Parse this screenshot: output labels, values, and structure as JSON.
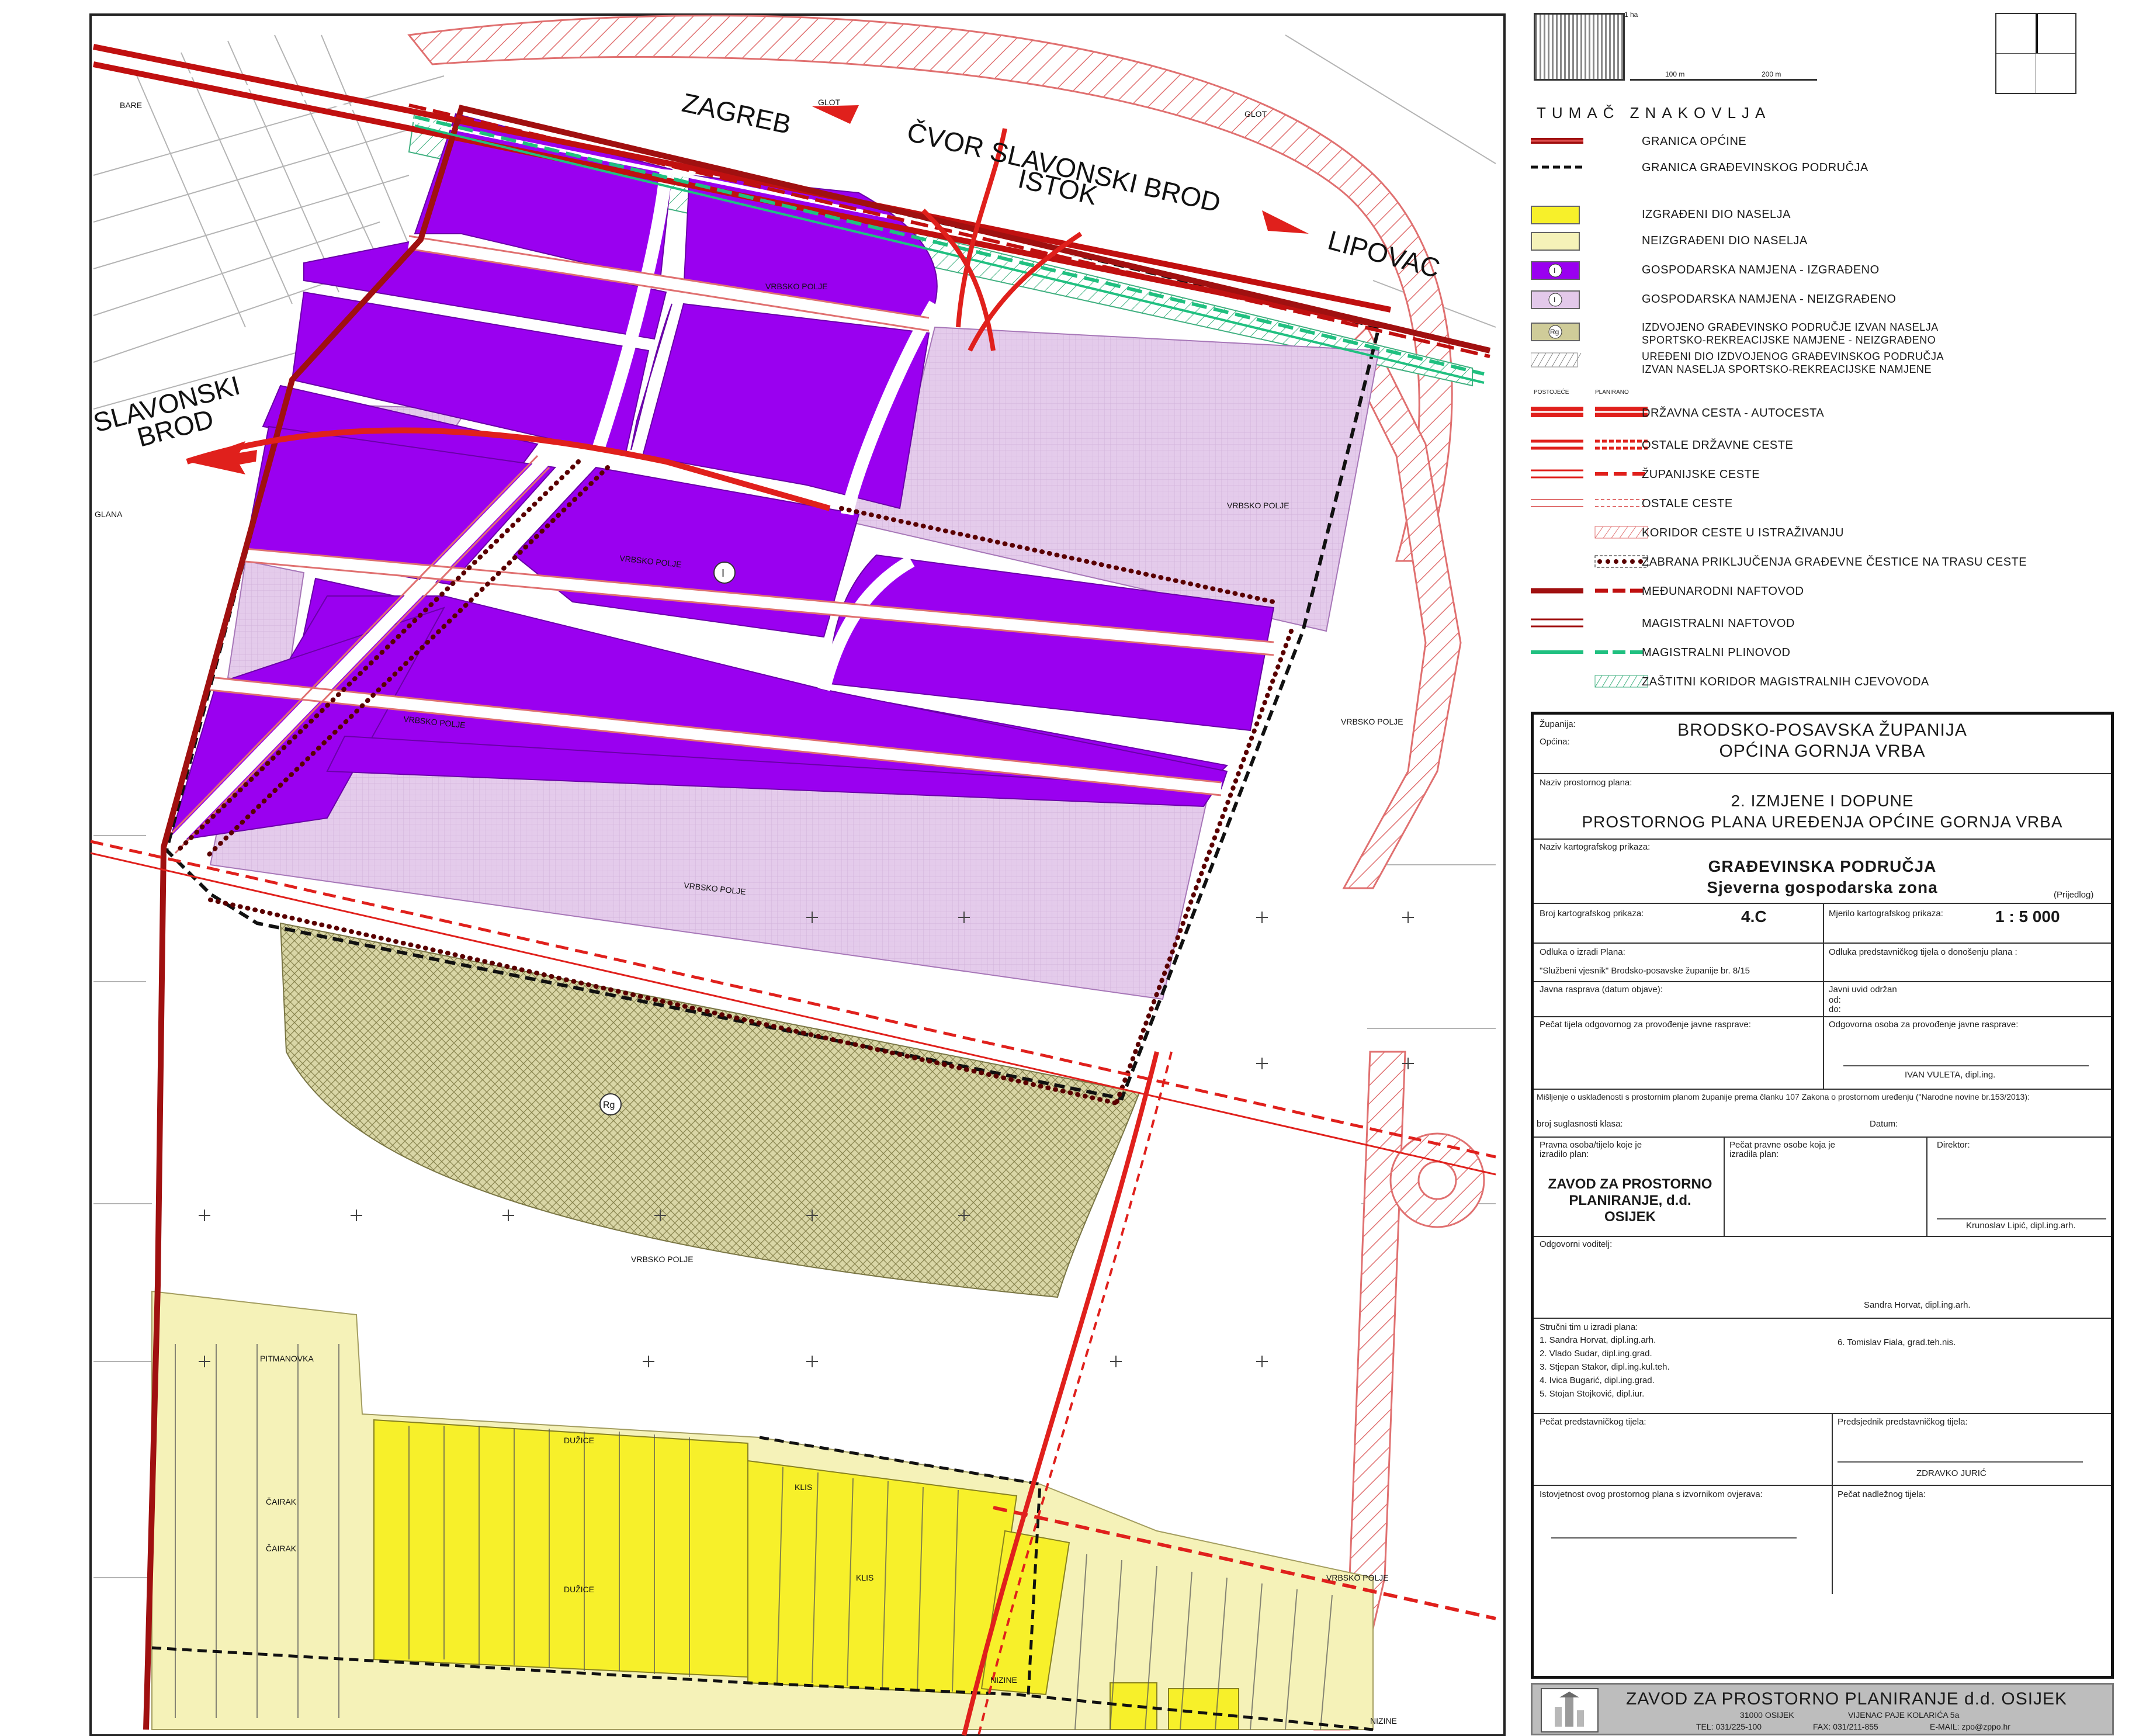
{
  "map": {
    "labels": {
      "zagreb": "ZAGREB",
      "cvor": "ČVOR SLAVONSKI BROD",
      "istok": "ISTOK",
      "lipovac": "LIPOVAC",
      "slavonski": "SLAVONSKI",
      "brod": "BROD",
      "glot1": "GLOT",
      "glot2": "GLOT",
      "bare": "BARE",
      "glana": "GLANA",
      "vrbsko_polje": "VRBSKO POLJE",
      "vrbsko_polje_2": "VRBSKO POLJE",
      "vrbsko_polje_3": "VRBSKO POLJE",
      "vrbsko_polje_4": "VRBSKO POLJE",
      "vrbsko_polje_5": "VRBSKO POLJE",
      "vrbsko_polje_6": "VRBSKO POLJE",
      "vrbsko_polje_7": "VRBSKO POLJE",
      "vrbsko_polje_8": "VRBSKO POLJE",
      "pitmanovka": "PITMANOVKA",
      "cairak1": "ČAIRAK",
      "cairak2": "ČAIRAK",
      "duzice1": "DUŽICE",
      "duzice2": "DUŽICE",
      "klis1": "KLIS",
      "klis2": "KLIS",
      "nizine1": "NIZINE",
      "nizine2": "NIZINE",
      "zone_i": "I",
      "zone_rg": "Rg"
    },
    "colors": {
      "built_settlement": "#f7f02a",
      "unbuilt_settlement": "#f5f2b8",
      "econ_built": "#9a00f0",
      "econ_unbuilt": "#e3c9ea",
      "sport_zone": "#cfcc99",
      "road_red": "#e0201c",
      "border_red": "#a01010",
      "gas_green": "#20c080"
    }
  },
  "legend": {
    "scale_1ha": "1 ha",
    "scale_100": "100 m",
    "scale_200": "200 m",
    "heading": "TUMAČ ZNAKOVLJA",
    "col_existing": "POSTOJEĆE",
    "col_planned": "PLANIRANO",
    "items": [
      {
        "label": "GRANICA OPĆINE",
        "sym": "border"
      },
      {
        "label": "GRANICA GRAĐEVINSKOG PODRUČJA",
        "sym": "dashblack"
      },
      {
        "label": "IZGRAĐENI DIO NASELJA",
        "sym": "yellow"
      },
      {
        "label": "NEIZGRAĐENI DIO NASELJA",
        "sym": "paleyellow"
      },
      {
        "label": "GOSPODARSKA NAMJENA - IZGRAĐENO",
        "sym": "purple",
        "mark": "I"
      },
      {
        "label": "GOSPODARSKA NAMJENA - NEIZGRAĐENO",
        "sym": "lilac",
        "mark": "I"
      },
      {
        "label": "IZDVOJENO GRAĐEVINSKO PODRUČJE IZVAN NASELJA",
        "label2": "SPORTSKO-REKREACIJSKE NAMJENE - NEIZGRAĐENO",
        "sym": "olive",
        "mark": "Rg"
      },
      {
        "label": "UREĐENI DIO IZDVOJENOG GRAĐEVINSKOG PODRUČJA",
        "label2": "IZVAN NASELJA SPORTSKO-REKREACIJSKE NAMJENE",
        "sym": "hatch"
      },
      {
        "label": "DRŽAVNA CESTA - AUTOCESTA",
        "sym": "motorway"
      },
      {
        "label": "OSTALE DRŽAVNE CESTE",
        "sym": "stateroad"
      },
      {
        "label": "ŽUPANIJSKE CESTE",
        "sym": "countyroad"
      },
      {
        "label": "OSTALE CESTE",
        "sym": "otherroad"
      },
      {
        "label": "KORIDOR CESTE U ISTRAŽIVANJU",
        "sym": "corridor"
      },
      {
        "label": "ZABRANA PRIKLJUČENJA GRAĐEVNE ČESTICE NA TRASU CESTE",
        "sym": "dots"
      },
      {
        "label": "MEĐUNARODNI NAFTOVOD",
        "sym": "intoil"
      },
      {
        "label": "MAGISTRALNI NAFTOVOD",
        "sym": "magoil"
      },
      {
        "label": "MAGISTRALNI PLINOVOD",
        "sym": "gas"
      },
      {
        "label": "ZAŠTITNI KORIDOR MAGISTRALNIH CJEVOVODA",
        "sym": "pipecorridor"
      }
    ]
  },
  "title_block": {
    "zupanija_cap": "Županija:",
    "opcina_cap": "Općina:",
    "zupanija": "BRODSKO-POSAVSKA ŽUPANIJA",
    "opcina": "OPĆINA GORNJA VRBA",
    "plan_cap": "Naziv prostornog plana:",
    "plan_line1": "2. IZMJENE I DOPUNE",
    "plan_line2": "PROSTORNOG PLANA UREĐENJA OPĆINE GORNJA VRBA",
    "map_cap": "Naziv kartografskog prikaza:",
    "map_title": "GRAĐEVINSKA PODRUČJA",
    "map_subtitle": "Sjeverna gospodarska zona",
    "draft": "(Prijedlog)",
    "number_cap": "Broj kartografskog prikaza:",
    "number": "4.C",
    "scale_cap": "Mjerilo kartografskog prikaza:",
    "scale": "1 : 5 000",
    "decision_cap": "Odluka o izradi Plana:",
    "decision_val": "\"Službeni vjesnik\" Brodsko-posavske županije br. 8/15",
    "decision2_cap": "Odluka predstavničkog tijela o donošenju plana :",
    "debate_cap": "Javna rasprava (datum objave):",
    "inspect_cap": "Javni uvid održan",
    "od": "od:",
    "do": "do:",
    "stamp_cap": "Pečat tijela odgovornog za provođenje javne rasprave:",
    "resp_cap": "Odgovorna osoba za provođenje javne rasprave:",
    "resp_name": "IVAN VULETA, dipl.ing.",
    "opinion": "Mišljenje o usklađenosti s prostornim planom županije prema članku 107 Zakona o prostornom uređenju (\"Narodne novine br.153/2013):",
    "klasa_cap": "broj suglasnosti klasa:",
    "date_cap": "Datum:",
    "maker_cap1": "Pravna osoba/tijelo koje je",
    "maker_cap2": "izradilo plan:",
    "maker1": "ZAVOD ZA PROSTORNO",
    "maker2": "PLANIRANJE, d.d.",
    "maker3": "OSIJEK",
    "seal_cap1": "Pečat pravne osobe koja je",
    "seal_cap2": "izradila plan:",
    "director_cap": "Direktor:",
    "director_name": "Krunoslav Lipić, dipl.ing.arh.",
    "leader_cap": "Odgovorni voditelj:",
    "leader_name": "Sandra Horvat, dipl.ing.arh.",
    "team_cap": "Stručni tim u izradi plana:",
    "team": [
      "1.   Sandra Horvat, dipl.ing.arh.",
      "2.   Vlado Sudar, dipl.ing.grad.",
      "3.   Stjepan Stakor, dipl.ing.kul.teh.",
      "4.   Ivica Bugarić, dipl.ing.grad.",
      "5.   Stojan Stojković, dipl.iur."
    ],
    "team6": "6.   Tomislav Fiala, grad.teh.nis.",
    "rep_stamp_cap": "Pečat predstavničkog tijela:",
    "president_cap": "Predsjednik predstavničkog tijela:",
    "president_name": "ZDRAVKO JURIĆ",
    "identity_cap": "Istovjetnost ovog prostornog plana s izvornikom ovjerava:",
    "authority_cap": "Pečat nadležnog tijela:"
  },
  "footer": {
    "company": "ZAVOD ZA PROSTORNO PLANIRANJE d.d. OSIJEK",
    "address_city": "31000 OSIJEK",
    "address_street": "VIJENAC PAJE KOLARIĆA 5a",
    "phone": "TEL: 031/225-100",
    "fax": "FAX: 031/211-855",
    "email": "E-MAIL: zpo@zppo.hr"
  }
}
